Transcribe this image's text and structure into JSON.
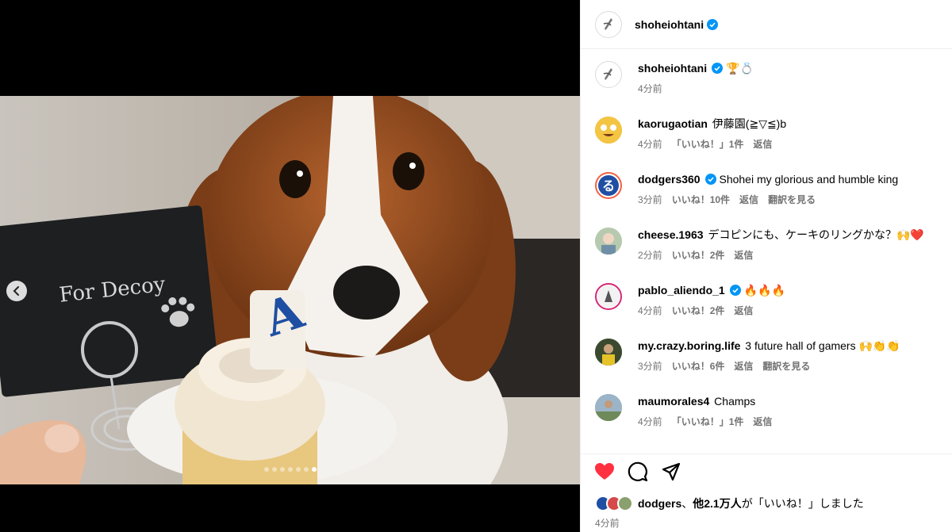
{
  "colors": {
    "verified": "#0095f6",
    "heart": "#ff3040",
    "meta_text": "#737373",
    "dodgers_blue": "#1f4fa3",
    "media_bg": "#000000"
  },
  "media": {
    "prev_icon": "chevron-left-icon",
    "card_text": "For Decoy",
    "carousel_dot_count": 7,
    "carousel_active_index": 6
  },
  "header": {
    "username": "shoheiohtani",
    "verified_icon": "verified-badge-icon"
  },
  "caption": {
    "username": "shoheiohtani",
    "emoji": "🏆💍",
    "time": "4分前"
  },
  "comments": [
    {
      "username": "kaorugaotian",
      "text": "伊藤園(≧▽≦)b",
      "time": "4分前",
      "likes": "「いいね！」1件",
      "reply": "返信",
      "translate": ""
    },
    {
      "username": "dodgers360",
      "verified": true,
      "text": "Shohei my glorious and humble king",
      "time": "3分前",
      "likes": "いいね！10件",
      "reply": "返信",
      "translate": "翻訳を見る"
    },
    {
      "username": "cheese.1963",
      "text": "デコピンにも、ケーキのリングかな？🙌❤️",
      "time": "2分前",
      "likes": "いいね！2件",
      "reply": "返信",
      "translate": ""
    },
    {
      "username": "pablo_aliendo_1",
      "verified": true,
      "text": "🔥🔥🔥",
      "time": "4分前",
      "likes": "いいね！2件",
      "reply": "返信",
      "translate": ""
    },
    {
      "username": "my.crazy.boring.life",
      "text": "3 future hall of gamers 🙌👏👏",
      "time": "3分前",
      "likes": "いいね！6件",
      "reply": "返信",
      "translate": "翻訳を見る"
    },
    {
      "username": "maumorales4",
      "text": "Champs",
      "time": "4分前",
      "likes": "「いいね！」1件",
      "reply": "返信",
      "translate": ""
    }
  ],
  "actions": {
    "like_icon": "heart-icon",
    "comment_icon": "comment-icon",
    "share_icon": "share-icon"
  },
  "likes_summary": {
    "user": "dodgers",
    "separator": "、",
    "others": "他2.1万人",
    "suffix": "が「いいね！」しました"
  },
  "post_time": "4分前"
}
